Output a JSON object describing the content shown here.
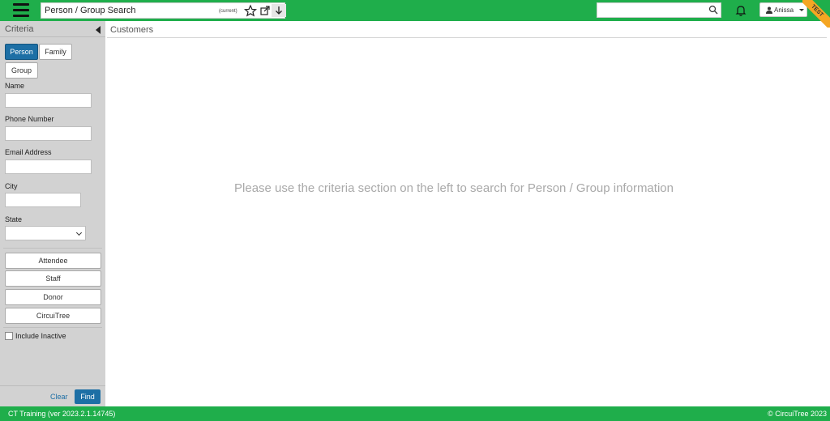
{
  "header": {
    "page_title": "Person / Group Search",
    "current_tag": "(current)",
    "search_placeholder": "",
    "user_name": "Anissa",
    "env_badge": "TEST"
  },
  "sidebar": {
    "title": "Criteria",
    "type_buttons": [
      {
        "label": "Person",
        "active": true
      },
      {
        "label": "Family",
        "active": false
      },
      {
        "label": "Group",
        "active": false
      }
    ],
    "fields": {
      "name_label": "Name",
      "name_value": "",
      "phone_label": "Phone Number",
      "phone_value": "",
      "email_label": "Email Address",
      "email_value": "",
      "city_label": "City",
      "city_value": "",
      "state_label": "State",
      "state_value": ""
    },
    "role_buttons": [
      "Attendee",
      "Staff",
      "Donor",
      "CircuiTree"
    ],
    "include_inactive_label": "Include Inactive",
    "include_inactive_checked": false,
    "clear_label": "Clear",
    "find_label": "Find"
  },
  "main": {
    "tab_label": "Customers",
    "empty_message": "Please use the criteria section on the left to search for Person / Group information"
  },
  "footer": {
    "version": "CT Training (ver 2023.2.1.14745)",
    "copyright": "© CircuiTree 2023"
  },
  "colors": {
    "brand_green": "#1fae4b",
    "primary_blue": "#1d6fa5",
    "sidebar_gray": "#d2d2d2",
    "ribbon_orange": "#f5a623"
  }
}
